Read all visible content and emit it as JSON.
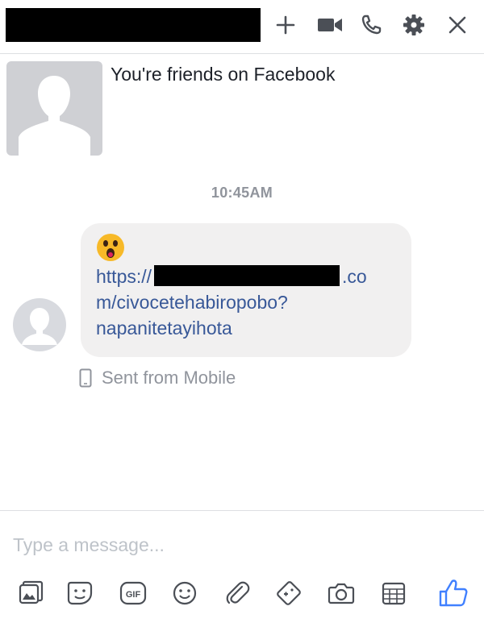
{
  "header": {
    "name_redacted": true,
    "icons": [
      "add-icon",
      "video-call-icon",
      "phone-call-icon",
      "settings-gear-icon",
      "close-icon"
    ]
  },
  "conversation": {
    "friends_notice": "You're friends on Facebook",
    "timestamp": "10:45AM",
    "message": {
      "emoji": "astonished-face-emoji",
      "link_prefix": "https://",
      "link_line1_suffix": ".co",
      "link_line2": "m/civocetehabiropobo?",
      "link_line3": "napanitetayihota"
    },
    "sent_from": "Sent from Mobile"
  },
  "composer": {
    "placeholder": "Type a message...",
    "toolbar_icons": [
      "photo-icon",
      "sticker-icon",
      "gif-icon",
      "emoji-icon",
      "attachment-icon",
      "game-controller-icon",
      "camera-icon",
      "calendar-icon",
      "thumbs-up-icon"
    ]
  },
  "colors": {
    "link": "#385898",
    "icon": "#90949c",
    "like": "#4080ff",
    "bubble": "#f1f0f0"
  }
}
